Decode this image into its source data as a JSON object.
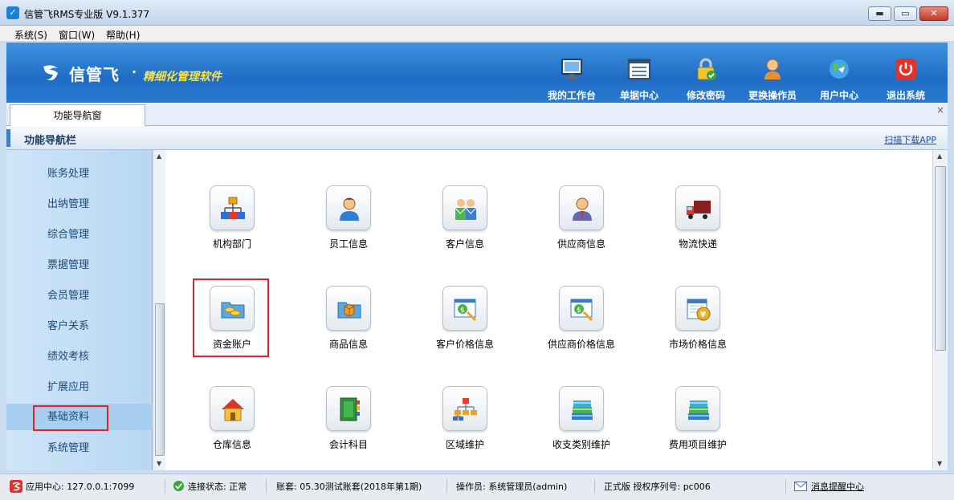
{
  "window": {
    "title": "信管飞RMS专业版 V9.1.377",
    "min": "▬",
    "max": "▭",
    "close": "✕"
  },
  "menu": [
    {
      "label": "系统(S)"
    },
    {
      "label": "窗口(W)"
    },
    {
      "label": "帮助(H)"
    }
  ],
  "banner": {
    "logo": "信管飞",
    "dot": "·",
    "slogan": "精细化管理软件",
    "tools": [
      {
        "label": "我的工作台",
        "icon": "monitor-icon"
      },
      {
        "label": "单据中心",
        "icon": "document-list-icon"
      },
      {
        "label": "修改密码",
        "icon": "lock-icon"
      },
      {
        "label": "更换操作员",
        "icon": "user-icon"
      },
      {
        "label": "用户中心",
        "icon": "globe-icon"
      },
      {
        "label": "退出系统",
        "icon": "power-icon"
      }
    ]
  },
  "tabs": {
    "active": "功能导航窗",
    "close": "×"
  },
  "nav": {
    "title": "功能导航栏",
    "download": "扫描下载APP"
  },
  "sidebar": {
    "items": [
      {
        "label": "账务处理"
      },
      {
        "label": "出纳管理"
      },
      {
        "label": "综合管理"
      },
      {
        "label": "票据管理"
      },
      {
        "label": "会员管理"
      },
      {
        "label": "客户关系"
      },
      {
        "label": "绩效考核"
      },
      {
        "label": "扩展应用"
      },
      {
        "label": "基础资料"
      },
      {
        "label": "系统管理"
      }
    ],
    "active": "基础资料"
  },
  "grid": [
    {
      "label": "机构部门",
      "icon": "org-chart-icon"
    },
    {
      "label": "员工信息",
      "icon": "employee-icon"
    },
    {
      "label": "客户信息",
      "icon": "customers-icon"
    },
    {
      "label": "供应商信息",
      "icon": "supplier-icon"
    },
    {
      "label": "物流快递",
      "icon": "truck-icon"
    },
    {
      "label": "资金账户",
      "icon": "fund-account-icon"
    },
    {
      "label": "商品信息",
      "icon": "product-box-icon"
    },
    {
      "label": "客户价格信息",
      "icon": "price-search-icon"
    },
    {
      "label": "供应商价格信息",
      "icon": "price-search-icon"
    },
    {
      "label": "市场价格信息",
      "icon": "market-price-icon"
    },
    {
      "label": "仓库信息",
      "icon": "warehouse-house-icon"
    },
    {
      "label": "会计科目",
      "icon": "ledger-book-icon"
    },
    {
      "label": "区域维护",
      "icon": "region-tree-icon"
    },
    {
      "label": "收支类别维护",
      "icon": "books-icon"
    },
    {
      "label": "费用项目维护",
      "icon": "books-icon"
    }
  ],
  "selected_item": "资金账户",
  "status": {
    "app_center": "应用中心: 127.0.0.1:7099",
    "connection": "连接状态: 正常",
    "account_set": "账套: 05.30测试账套(2018年第1期)",
    "operator": "操作员: 系统管理员(admin)",
    "license": "正式版 授权序列号: pc006",
    "messages": "消息提醒中心"
  },
  "colors": {
    "accent": "#1f6cc4",
    "highlight": "#e0242a",
    "slogan": "#f4e24a"
  }
}
